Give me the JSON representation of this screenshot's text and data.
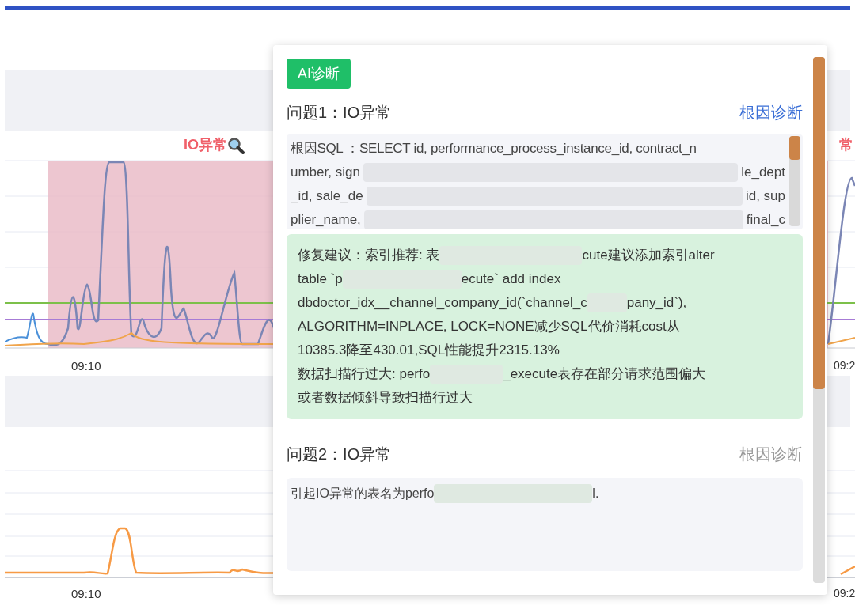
{
  "charts": [
    {
      "anomaly_label": "IO异常",
      "edge_label": "常",
      "x_labels": [
        "09:10",
        "09:2"
      ]
    },
    {
      "x_labels": [
        "09:10",
        "09:2"
      ]
    }
  ],
  "panel": {
    "button": "AI诊断",
    "issues": [
      {
        "title": "问题1：IO异常",
        "link": "根因诊断",
        "link_active": true,
        "sql_lines": [
          [
            "根因SQL ：SELECT id, performance_process_instance_id, contract_n"
          ],
          [
            "umber, sign",
            "le_dept"
          ],
          [
            "_id, sale_de",
            "id, sup"
          ],
          [
            "plier_name,",
            "final_c"
          ]
        ],
        "advice_lines": [
          [
            "修复建议：索引推荐: 表",
            "cute建议添加索引alter"
          ],
          [
            "table `p",
            "ecute` add index"
          ],
          [
            "dbdoctor_idx__channel_company_id(`channel_c",
            "pany_id`),"
          ],
          [
            "ALGORITHM=INPLACE, LOCK=NONE减少SQL代价消耗cost从"
          ],
          [
            "10385.3降至430.01,SQL性能提升2315.13%"
          ],
          [
            "数据扫描行过大: perfo",
            "_execute表存在部分请求范围偏大"
          ],
          [
            "或者数据倾斜导致扫描行过大"
          ]
        ]
      },
      {
        "title": "问题2：IO异常",
        "link": "根因诊断",
        "link_active": false,
        "detail_lines": [
          [
            "引起IO异常的表名为perfo",
            "l."
          ]
        ]
      }
    ]
  }
}
